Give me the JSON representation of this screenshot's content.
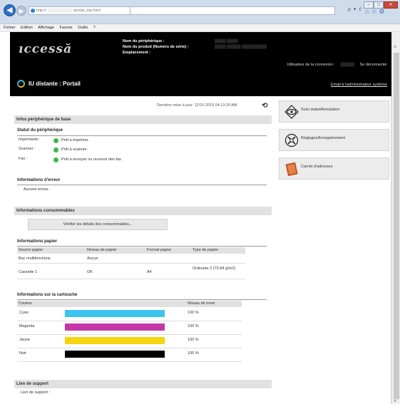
{
  "browser": {
    "address": "http://",
    "address_rest": "/portal_top.html",
    "search_arrow": "ρ ▾ ć",
    "window_min": "–",
    "window_max": "□",
    "window_close": "✕",
    "tab_icons": "⌂☆⚙"
  },
  "menu": [
    "Fichier",
    "Edition",
    "Affichage",
    "Favoris",
    "Outils",
    "?"
  ],
  "banner": {
    "logo": "ıccessă",
    "device_labels": [
      "Nom du périphérique :",
      "Nom du produit (Numéro de série) :",
      "Emplacement :"
    ],
    "login_label": "Utilisateur de la connexion :",
    "logout": "Se déconnecter",
    "portal_title": "IU distante : Portail",
    "mail_link": "Email à l'administrateur système"
  },
  "last_update": "Dernière mise à jour: 12/10 2015 04:13:20 AM",
  "basic_info": {
    "title": "Infos périphérique de base",
    "status_heading": "Statut du périphérique",
    "rows": [
      {
        "label": "Imprimante :",
        "status": "Prêt à imprimer."
      },
      {
        "label": "Scanner :",
        "status": "Prêt à scanner."
      },
      {
        "label": "Fax :",
        "status": "Prêt à envoyer ou recevoir des fax."
      }
    ],
    "status_color": "#3cb94a",
    "error_heading": "Informations d'erreur",
    "error_text": "Aucune erreur."
  },
  "consumables": {
    "title": "Informations consommables",
    "button": "Vérifier les détails des consommables...",
    "paper_heading": "Informations papier",
    "paper_columns": [
      "Source papier",
      "Niveau de papier",
      "Format papier",
      "Type de papier"
    ],
    "paper_rows": [
      [
        "Bac multifonctions",
        "Aucun",
        "",
        ""
      ],
      [
        "Cassette 1",
        "OK",
        "A4",
        "Ordinaire 2 (70-84 g/m2)"
      ]
    ],
    "toner_heading": "Informations sur la cartouche",
    "toner_columns": [
      "Couleur",
      "",
      "Niveau de toner"
    ],
    "toners": [
      {
        "name": "Cyan",
        "color": "#3cc4ee",
        "level_text": "100 %",
        "level": 1.0
      },
      {
        "name": "Magenta",
        "color": "#c636a8",
        "level_text": "100 %",
        "level": 1.0
      },
      {
        "name": "Jaune",
        "color": "#f6d40e",
        "level_text": "100 %",
        "level": 1.0
      },
      {
        "name": "Noir",
        "color": "#000000",
        "level_text": "100 %",
        "level": 1.0
      }
    ]
  },
  "support": {
    "title": "Lien de support",
    "label": "Lien de support :"
  },
  "side_buttons": [
    {
      "label": "Suivi statut/Annulation",
      "icon": "eye-icon"
    },
    {
      "label": "Réglages/Enregistrement",
      "icon": "settings-icon"
    },
    {
      "label": "Carnet d'adresses",
      "icon": "address-book-icon"
    }
  ]
}
